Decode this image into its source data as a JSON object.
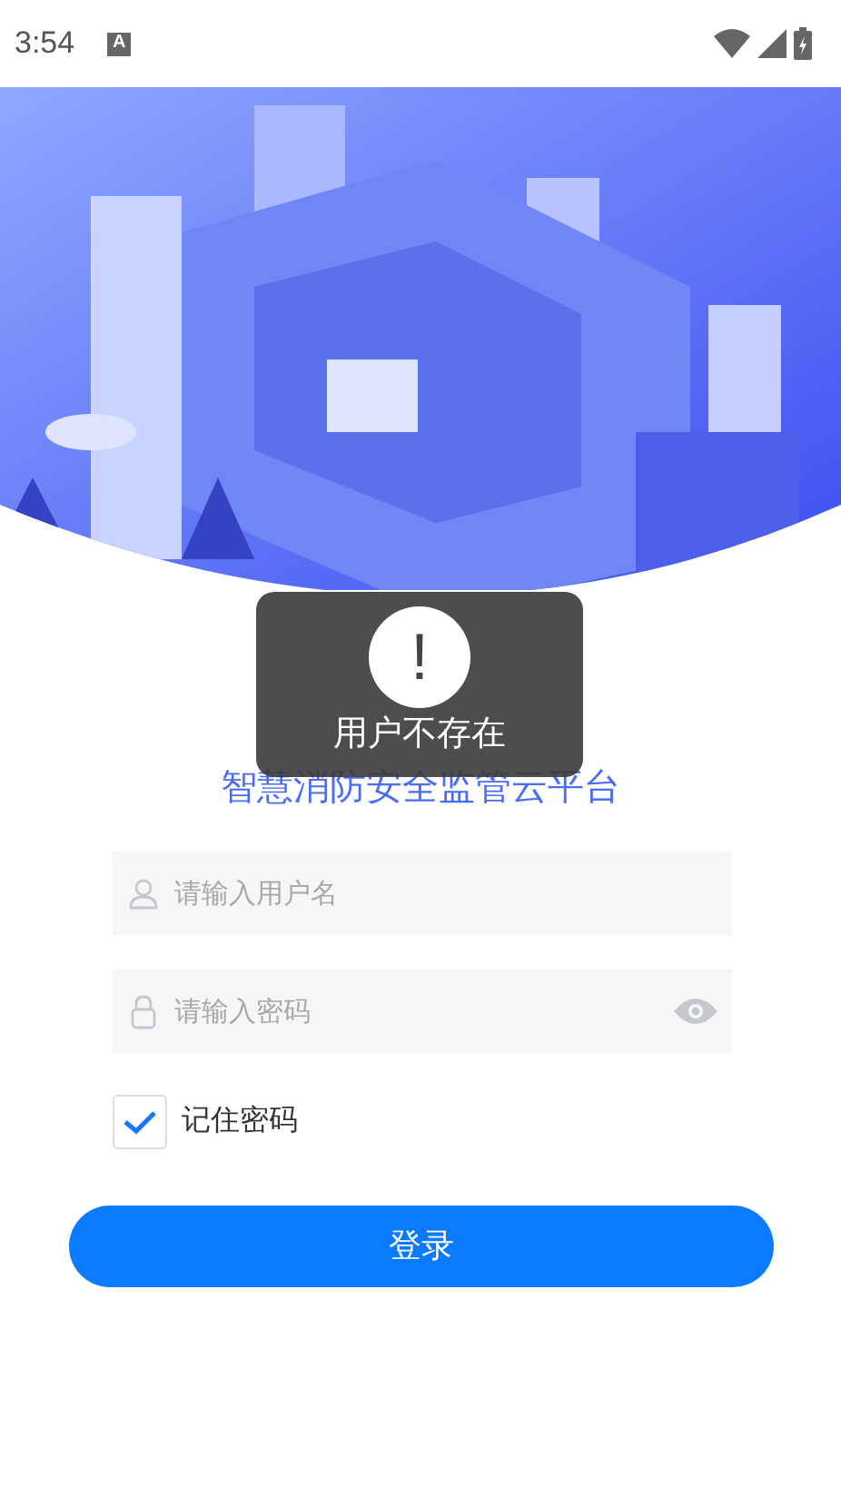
{
  "status_bar": {
    "time": "3:54",
    "notification": "A"
  },
  "title": "智慧消防安全监管云平台",
  "username_field": {
    "placeholder": "请输入用户名"
  },
  "password_field": {
    "placeholder": "请输入密码"
  },
  "remember": {
    "label": "记住密码",
    "checked": true
  },
  "login_button": "登录",
  "toast": {
    "message": "用户不存在",
    "icon": "!"
  }
}
